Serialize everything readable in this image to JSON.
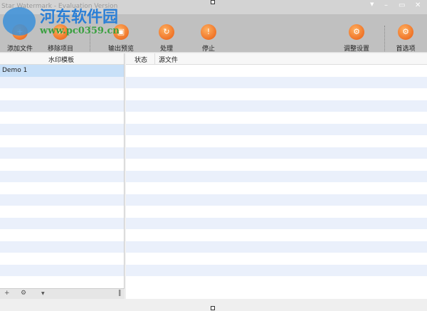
{
  "window": {
    "title": "Star Watermark - Evaluation Version"
  },
  "toolbar": {
    "items": [
      {
        "label": "添加文件",
        "icon": "add-file-icon"
      },
      {
        "label": "移除项目",
        "icon": "remove-item-icon"
      },
      {
        "label": "输出预览",
        "icon": "preview-icon"
      },
      {
        "label": "处理",
        "icon": "process-icon"
      },
      {
        "label": "停止",
        "icon": "stop-icon"
      },
      {
        "label": "调整设置",
        "icon": "settings-icon"
      },
      {
        "label": "首选项",
        "icon": "preferences-icon"
      }
    ]
  },
  "left": {
    "header": "水印模板",
    "items": [
      "Demo 1"
    ]
  },
  "right": {
    "columns": [
      "状态",
      "源文件"
    ]
  },
  "watermark": {
    "name": "河东软件园",
    "url": "www.pc0359.cn"
  }
}
